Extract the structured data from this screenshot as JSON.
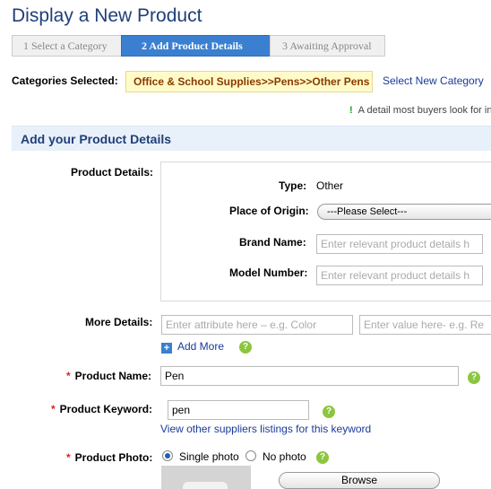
{
  "page": {
    "title": "Display a New Product"
  },
  "steps": [
    {
      "label": "1  Select a Category"
    },
    {
      "label": "2  Add Product Details"
    },
    {
      "label": "3  Awaiting Approval"
    }
  ],
  "categories": {
    "label": "Categories Selected:",
    "value": "Office & School Supplies>>Pens>>Other Pens",
    "change_link": "Select New Category"
  },
  "hint": {
    "mark": "!",
    "text": "A detail most buyers look for in"
  },
  "section": {
    "title": "Add your Product Details"
  },
  "product_details": {
    "label": "Product Details:",
    "type_label": "Type:",
    "type_value": "Other",
    "origin_label": "Place of Origin:",
    "origin_selected": "---Please Select---",
    "brand_label": "Brand Name:",
    "brand_placeholder": "Enter relevant product details h",
    "model_label": "Model Number:",
    "model_placeholder": "Enter relevant product details h"
  },
  "more_details": {
    "label": "More Details:",
    "attribute_placeholder": "Enter attribute here – e.g. Color",
    "value_placeholder": "Enter value here- e.g. Re",
    "add_more": "Add More"
  },
  "product_name": {
    "label": "Product Name:",
    "value": "Pen"
  },
  "product_keyword": {
    "label": "Product Keyword:",
    "value": "pen",
    "link": "View other suppliers listings for this keyword"
  },
  "product_photo": {
    "label": "Product Photo:",
    "option_single": "Single photo",
    "option_none": "No photo",
    "selected": "Single photo",
    "browse": "Browse"
  },
  "required_mark": "*",
  "help_glyph": "?",
  "plus_glyph": "+",
  "icons": [
    "plus-icon",
    "help-icon",
    "camera-icon"
  ]
}
